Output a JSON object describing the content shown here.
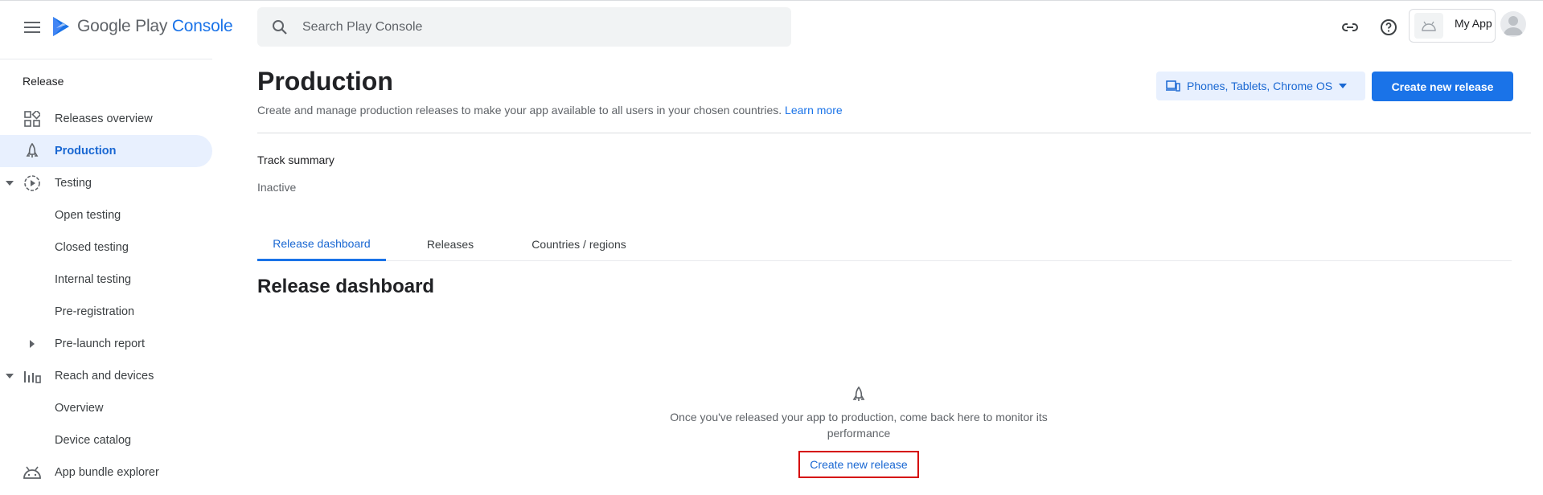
{
  "header": {
    "logo_primary": "Google Play",
    "logo_accent": "Console",
    "search_placeholder": "Search Play Console",
    "app_name": "My App"
  },
  "sidebar": {
    "section_label": "Release",
    "items": [
      {
        "label": "Releases overview",
        "icon": "dashboard-icon"
      },
      {
        "label": "Production",
        "icon": "rocket-icon",
        "active": true
      },
      {
        "label": "Testing",
        "icon": "play-circle-icon",
        "expanded": true
      },
      {
        "label": "Open testing"
      },
      {
        "label": "Closed testing"
      },
      {
        "label": "Internal testing"
      },
      {
        "label": "Pre-registration"
      },
      {
        "label": "Pre-launch report",
        "collapsed": true
      },
      {
        "label": "Reach and devices",
        "icon": "bar-chart-icon",
        "expanded": true
      },
      {
        "label": "Overview"
      },
      {
        "label": "Device catalog"
      },
      {
        "label": "App bundle explorer",
        "icon": "android-icon"
      }
    ]
  },
  "main": {
    "title": "Production",
    "description": "Create and manage production releases to make your app available to all users in your chosen countries.",
    "learn_more": "Learn more",
    "device_selector": "Phones, Tablets, Chrome OS",
    "create_release_button": "Create new release",
    "track_summary_label": "Track summary",
    "track_status": "Inactive",
    "tabs": [
      {
        "label": "Release dashboard",
        "active": true
      },
      {
        "label": "Releases"
      },
      {
        "label": "Countries / regions"
      }
    ],
    "section_title": "Release dashboard",
    "empty_state": {
      "message": "Once you've released your app to production, come back here to monitor its performance",
      "action": "Create new release"
    }
  },
  "colors": {
    "accent": "#1a73e8",
    "active_bg": "#e8f0fe",
    "highlight_border": "#d50000"
  }
}
